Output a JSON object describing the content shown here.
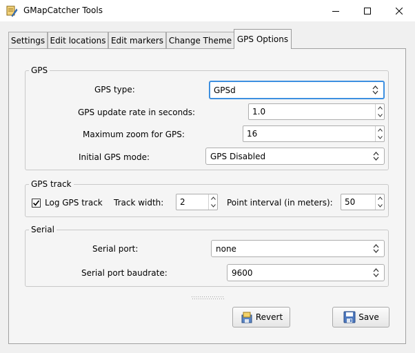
{
  "window": {
    "title": "GMapCatcher Tools"
  },
  "tabs": [
    {
      "label": "Settings"
    },
    {
      "label": "Edit locations"
    },
    {
      "label": "Edit markers"
    },
    {
      "label": "Change Theme"
    },
    {
      "label": "GPS Options"
    }
  ],
  "gps": {
    "group_title": "GPS",
    "type_label": "GPS type:",
    "type_value": "GPSd",
    "update_rate_label": "GPS update rate in seconds:",
    "update_rate_value": "1.0",
    "max_zoom_label": "Maximum zoom for GPS:",
    "max_zoom_value": "16",
    "mode_label": "Initial GPS mode:",
    "mode_value": "GPS Disabled"
  },
  "gps_track": {
    "group_title": "GPS track",
    "log_label": "Log GPS track",
    "log_checked": true,
    "width_label": "Track width:",
    "width_value": "2",
    "interval_label": "Point interval (in meters):",
    "interval_value": "50"
  },
  "serial": {
    "group_title": "Serial",
    "port_label": "Serial port:",
    "port_value": "none",
    "baud_label": "Serial port baudrate:",
    "baud_value": "9600"
  },
  "buttons": {
    "revert_label": "Revert",
    "save_label": "Save"
  },
  "colors": {
    "focus_border": "#3c8fe0",
    "close_hover": "#e81123"
  }
}
